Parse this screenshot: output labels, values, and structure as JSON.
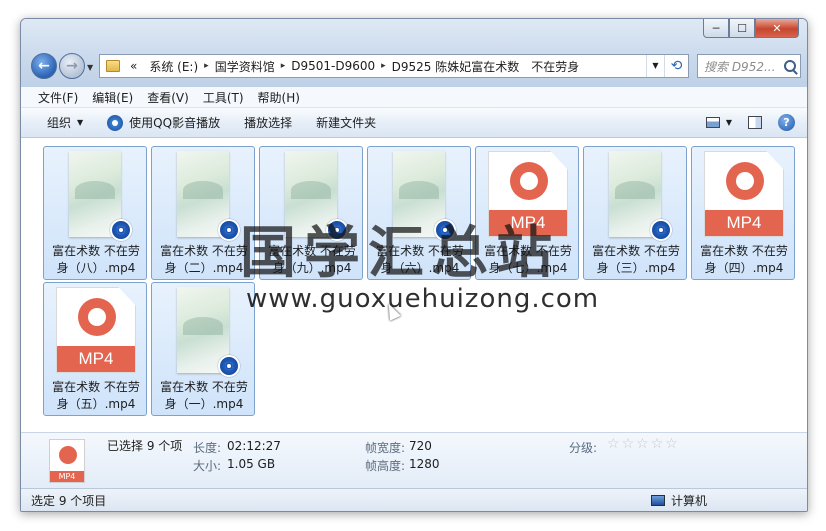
{
  "window": {
    "caption": {
      "minimize": "─",
      "maximize": "☐",
      "close": "✕"
    }
  },
  "address": {
    "prefix": "«",
    "crumbs": [
      "系统 (E:)",
      "国学资料馆",
      "D9501-D9600",
      "D9525 陈姝妃富在术数　不在劳身"
    ],
    "separator": "▸"
  },
  "search": {
    "placeholder": "搜索 D952..."
  },
  "menu": [
    "文件(F)",
    "编辑(E)",
    "查看(V)",
    "工具(T)",
    "帮助(H)"
  ],
  "toolbar": {
    "organize": "组织",
    "play_with_qq": "使用QQ影音播放",
    "play_selection": "播放选择",
    "new_folder": "新建文件夹"
  },
  "files": [
    {
      "name_line1": "富在术数 不在劳",
      "name_line2": "身（八）.mp4",
      "kind": "thumbnail"
    },
    {
      "name_line1": "富在术数 不在劳",
      "name_line2": "身（二）.mp4",
      "kind": "thumbnail"
    },
    {
      "name_line1": "富在术数 不在劳",
      "name_line2": "身（九）.mp4",
      "kind": "thumbnail"
    },
    {
      "name_line1": "富在术数 不在劳",
      "name_line2": "身（六）.mp4",
      "kind": "thumbnail"
    },
    {
      "name_line1": "富在术数 不在劳",
      "name_line2": "身（七）.mp4",
      "kind": "mp4-icon"
    },
    {
      "name_line1": "富在术数 不在劳",
      "name_line2": "身（三）.mp4",
      "kind": "thumbnail"
    },
    {
      "name_line1": "富在术数 不在劳",
      "name_line2": "身（四）.mp4",
      "kind": "mp4-icon"
    },
    {
      "name_line1": "富在术数 不在劳",
      "name_line2": "身（五）.mp4",
      "kind": "mp4-icon"
    },
    {
      "name_line1": "富在术数 不在劳",
      "name_line2": "身（一）.mp4",
      "kind": "thumbnail"
    }
  ],
  "mp4_label": "MP4",
  "watermark": {
    "chinese": "国学汇总站",
    "url": "www.guoxuehuizong.com"
  },
  "details": {
    "selected": "已选择 9 个项",
    "length_label": "长度:",
    "length_value": "02:12:27",
    "size_label": "大小:",
    "size_value": "1.05 GB",
    "frame_width_label": "帧宽度:",
    "frame_width_value": "720",
    "frame_height_label": "帧高度:",
    "frame_height_value": "1280",
    "rating_label": "分级:",
    "rating_stars": 0
  },
  "status": {
    "left": "选定 9 个项目",
    "right": "计算机"
  },
  "colors": {
    "accent": "#e4654f",
    "selection": "#cfe3fa",
    "badge": "#1c57b8"
  }
}
